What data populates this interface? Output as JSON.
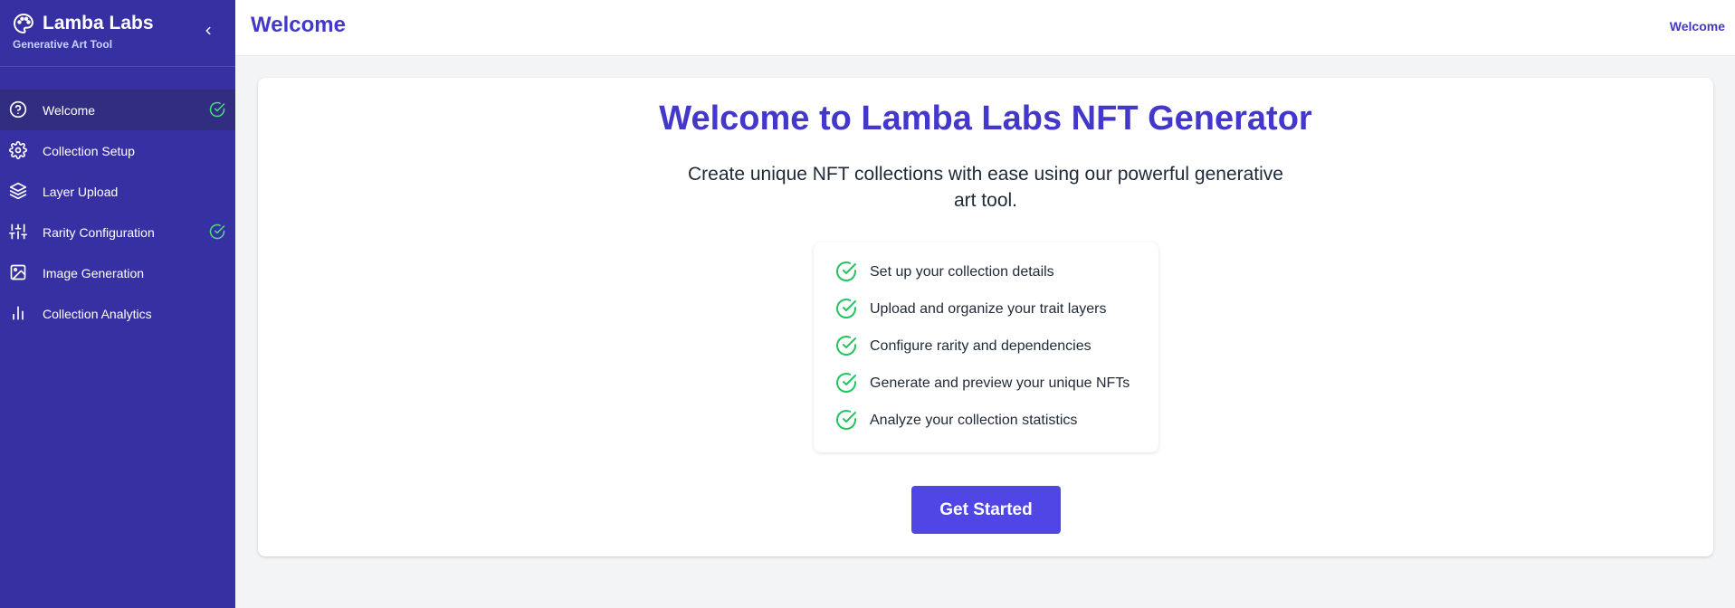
{
  "sidebar": {
    "brand_title": "Lamba Labs",
    "brand_subtitle": "Generative Art Tool",
    "brand_icon": "palette-icon",
    "collapse_icon": "chevron-left-icon",
    "items": [
      {
        "label": "Welcome",
        "icon": "help-circle-icon",
        "active": true,
        "completed": true
      },
      {
        "label": "Collection Setup",
        "icon": "gear-icon",
        "active": false,
        "completed": false
      },
      {
        "label": "Layer Upload",
        "icon": "layers-icon",
        "active": false,
        "completed": false
      },
      {
        "label": "Rarity Configuration",
        "icon": "sliders-icon",
        "active": false,
        "completed": true
      },
      {
        "label": "Image Generation",
        "icon": "image-icon",
        "active": false,
        "completed": false
      },
      {
        "label": "Collection Analytics",
        "icon": "bar-chart-icon",
        "active": false,
        "completed": false
      }
    ]
  },
  "header": {
    "title": "Welcome",
    "breadcrumb": "Welcome"
  },
  "main": {
    "title": "Welcome to Lamba Labs NFT Generator",
    "subtitle": "Create unique NFT collections with ease using our powerful generative art tool.",
    "features": [
      "Set up your collection details",
      "Upload and organize your trait layers",
      "Configure rarity and dependencies",
      "Generate and preview your unique NFTs",
      "Analyze your collection statistics"
    ],
    "cta_label": "Get Started"
  },
  "colors": {
    "sidebar_bg": "#3730a3",
    "sidebar_active": "#312e81",
    "accent": "#4338ca",
    "button": "#4f46e5",
    "check_green": "#22c55e",
    "page_bg": "#f3f4f6"
  }
}
